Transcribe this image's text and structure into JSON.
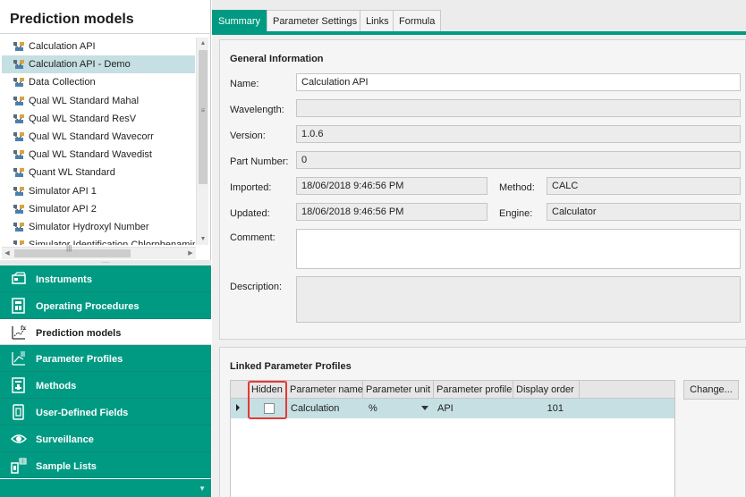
{
  "left_panel": {
    "title": "Prediction models",
    "models": [
      {
        "label": "Calculation API",
        "selected": false
      },
      {
        "label": "Calculation API - Demo",
        "selected": true
      },
      {
        "label": "Data Collection",
        "selected": false
      },
      {
        "label": "Qual WL Standard Mahal",
        "selected": false
      },
      {
        "label": "Qual WL Standard ResV",
        "selected": false
      },
      {
        "label": "Qual WL Standard Wavecorr",
        "selected": false
      },
      {
        "label": "Qual WL Standard Wavedist",
        "selected": false
      },
      {
        "label": "Quant WL Standard",
        "selected": false
      },
      {
        "label": "Simulator API 1",
        "selected": false
      },
      {
        "label": "Simulator API 2",
        "selected": false
      },
      {
        "label": "Simulator Hydroxyl Number",
        "selected": false
      },
      {
        "label": "Simulator Identification Chlorphenamine",
        "selected": false
      }
    ],
    "nav": [
      {
        "label": "Instruments",
        "icon": "instruments-icon",
        "active": false
      },
      {
        "label": "Operating Procedures",
        "icon": "operating-procedures-icon",
        "active": false
      },
      {
        "label": "Prediction models",
        "icon": "prediction-models-icon",
        "active": true
      },
      {
        "label": "Parameter Profiles",
        "icon": "parameter-profiles-icon",
        "active": false
      },
      {
        "label": "Methods",
        "icon": "methods-icon",
        "active": false
      },
      {
        "label": "User-Defined Fields",
        "icon": "user-defined-fields-icon",
        "active": false
      },
      {
        "label": "Surveillance",
        "icon": "eye-icon",
        "active": false
      },
      {
        "label": "Sample Lists",
        "icon": "sample-lists-icon",
        "active": false
      }
    ]
  },
  "tabs": [
    {
      "label": "Summary",
      "active": true
    },
    {
      "label": "Parameter Settings",
      "active": false
    },
    {
      "label": "Links",
      "active": false
    },
    {
      "label": "Formula",
      "active": false
    }
  ],
  "general": {
    "title": "General Information",
    "name_label": "Name:",
    "name_value": "Calculation API",
    "wavelength_label": "Wavelength:",
    "wavelength_value": "",
    "version_label": "Version:",
    "version_value": "1.0.6",
    "part_number_label": "Part Number:",
    "part_number_value": "0",
    "imported_label": "Imported:",
    "imported_value": "18/06/2018 9:46:56 PM",
    "method_label": "Method:",
    "method_value": "CALC",
    "updated_label": "Updated:",
    "updated_value": "18/06/2018 9:46:56 PM",
    "engine_label": "Engine:",
    "engine_value": "Calculator",
    "comment_label": "Comment:",
    "comment_value": "",
    "description_label": "Description:",
    "description_value": ""
  },
  "linked": {
    "title": "Linked Parameter Profiles",
    "columns": [
      "Hidden",
      "Parameter name",
      "Parameter unit",
      "Parameter profile",
      "Display order"
    ],
    "rows": [
      {
        "hidden": false,
        "parameter_name": "Calculation",
        "parameter_unit": "%",
        "parameter_profile": "API",
        "display_order": "101"
      }
    ],
    "change_button": "Change..."
  },
  "colors": {
    "accent": "#009a83",
    "selection": "#c5dfe3",
    "highlight": "#e53935"
  }
}
